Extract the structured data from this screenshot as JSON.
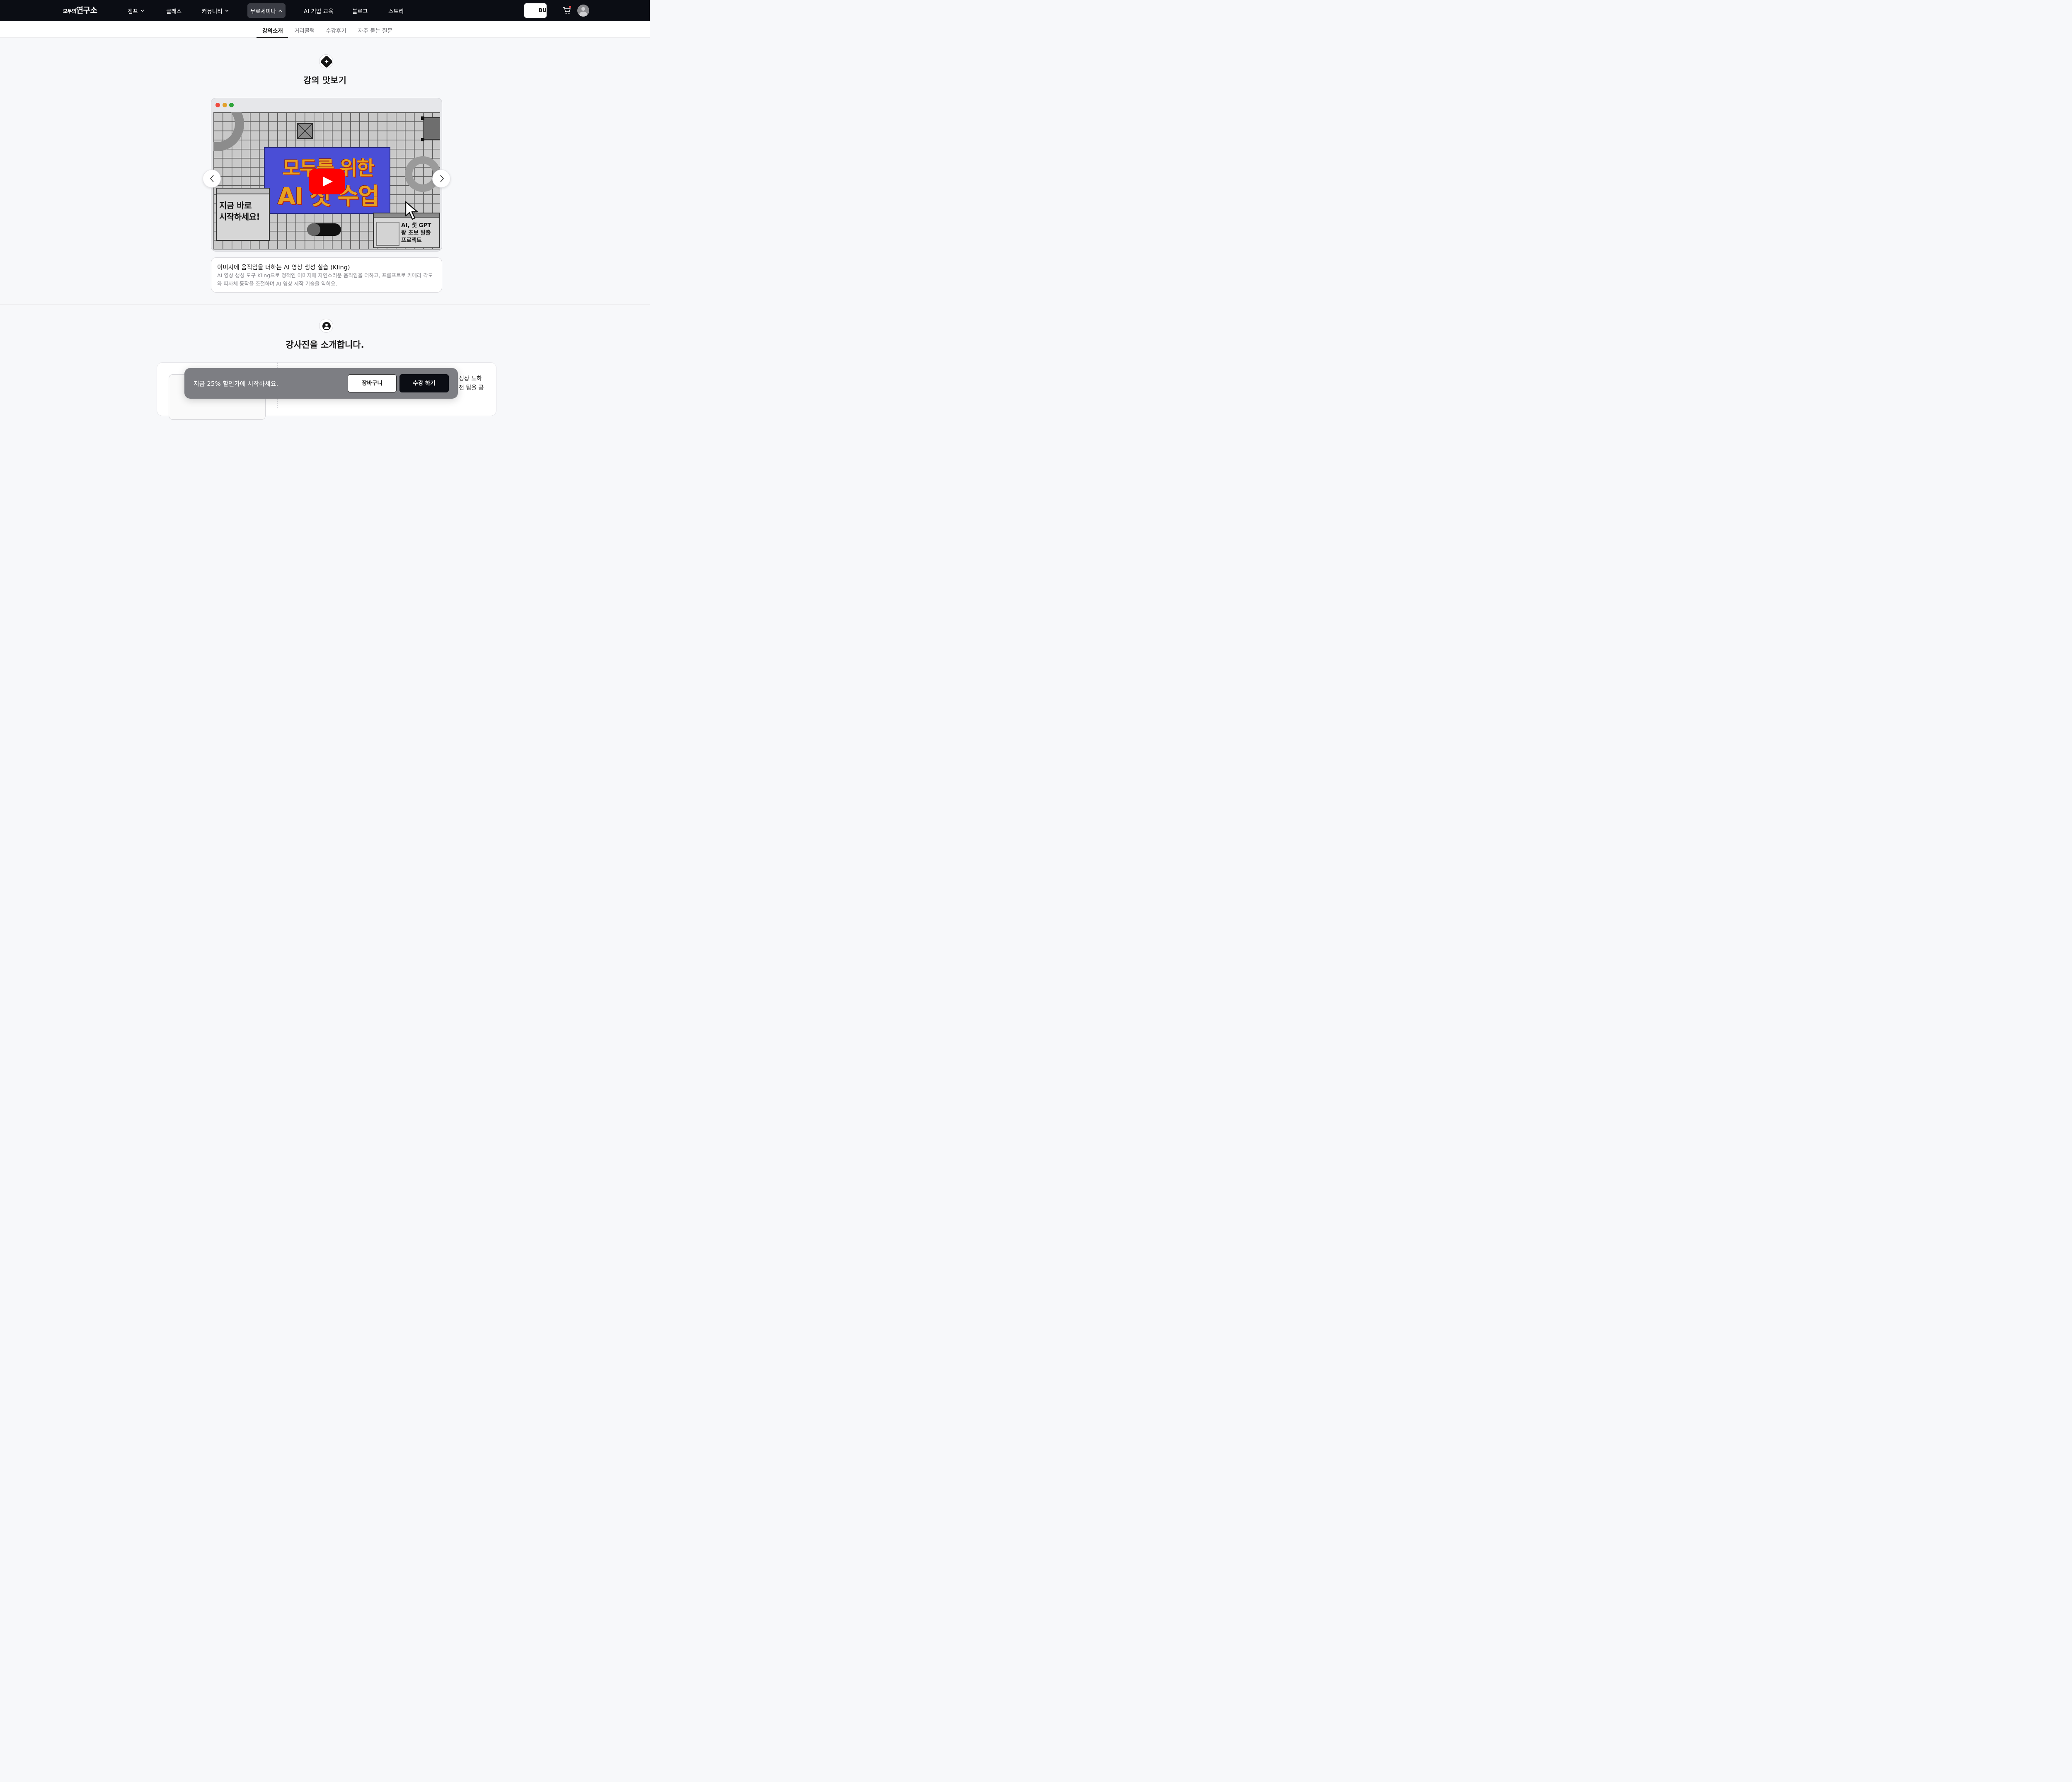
{
  "nav": {
    "logo_small": "모두의",
    "logo_big": "연구소",
    "items": [
      {
        "label": "캠프",
        "has_dropdown": true
      },
      {
        "label": "클래스",
        "has_dropdown": false
      },
      {
        "label": "커뮤니티",
        "has_dropdown": true
      },
      {
        "label": "무료세미나",
        "has_dropdown": true,
        "active": true
      },
      {
        "label": "AI 기업 교육",
        "has_dropdown": false
      },
      {
        "label": "블로그",
        "has_dropdown": false
      },
      {
        "label": "스토리",
        "has_dropdown": false
      }
    ],
    "chev_down": "⌄",
    "chev_up": "⌃",
    "button_label": "BU",
    "cart_icon": "cart-icon",
    "avatar_icon": "user-avatar-icon"
  },
  "tabs": [
    {
      "label": "강의소개",
      "active": true
    },
    {
      "label": "커리큘럼",
      "active": false
    },
    {
      "label": "수강후기",
      "active": false
    },
    {
      "label": "자주 묻는 질문",
      "active": false
    }
  ],
  "preview": {
    "title": "강의 맛보기",
    "thumbnail_line1": "모두를 위한",
    "thumbnail_line2": "AI 첫 수업",
    "left_card": "지금 바로\n시작하세요!",
    "right_card_line1": "AI, 챗 GPT",
    "right_card_line2": "왕 초보 탈출",
    "right_card_line3": "프로젝트",
    "prev_arrow": "‹",
    "next_arrow": "›",
    "video_heading": "이미지에 움직임을 더하는 AI 영상 생성 실습 (Kling)",
    "video_desc": "AI 영상 생성 도구 Kling으로 정적인 이미지에 자연스러운 움직임을 더하고, 프롬프트로 카메라 각도와 피사체 동작을 조절하며 AI 영상 제작 기술을 익혀요."
  },
  "instructor": {
    "title": "강사진을 소개합니다.",
    "text_line1": "성장 노하",
    "text_line2": "전 팁을 공"
  },
  "promo": {
    "message": "지금 25% 할인가에 시작하세요.",
    "cart_button": "장바구니",
    "enroll_button": "수강 하기"
  },
  "colors": {
    "nav_bg": "#0b0d14",
    "page_bg": "#f7f8fa",
    "youtube_red": "#ff0000",
    "thumbnail_blue": "#4a4ed6",
    "promo_bg": "#7d7e83"
  }
}
